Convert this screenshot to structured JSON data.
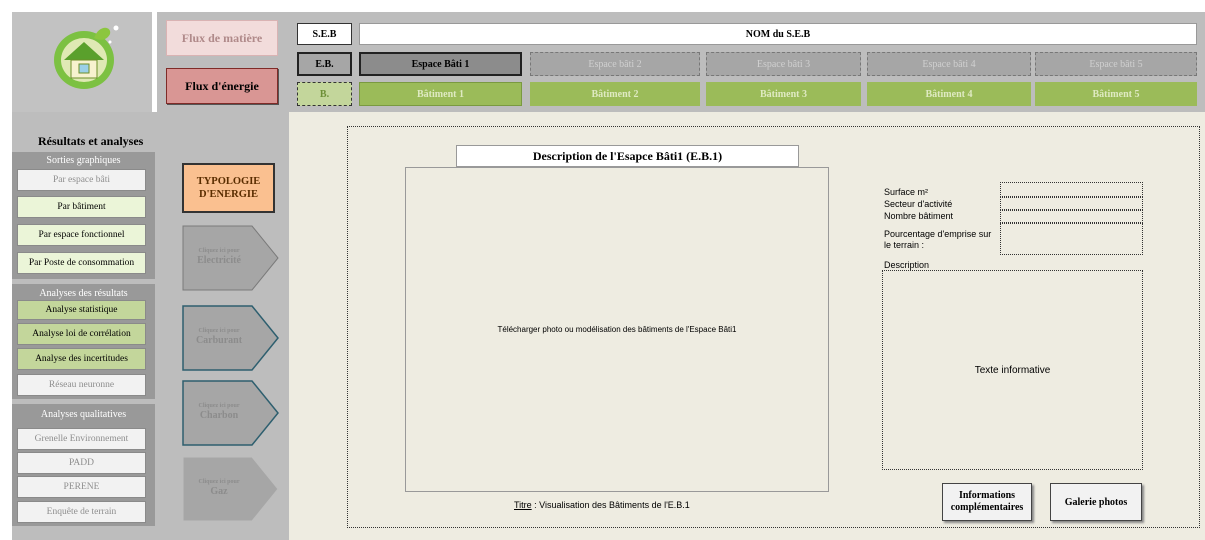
{
  "nav": {
    "flux_matiere": "Flux de matière",
    "flux_energie": "Flux d'énergie",
    "seb_label": "S.E.B",
    "seb_name": "NOM du S.E.B",
    "eb_label": "E.B.",
    "b_label": "B.",
    "espaces": [
      "Espace Bâti 1",
      "Espace bâti 2",
      "Espace bâti 3",
      "Espace bâti 4",
      "Espace bâti 5"
    ],
    "batiments": [
      "Bâtiment 1",
      "Bâtiment 2",
      "Bâtiment 3",
      "Bâtiment 4",
      "Bâtiment 5"
    ]
  },
  "sidebar": {
    "title": "Résultats et analyses",
    "graphiques_title": "Sorties graphiques",
    "graphiques": [
      "Par espace bâti",
      "Par bâtiment",
      "Par espace fonctionnel",
      "Par Poste de consommation"
    ],
    "resultats_title": "Analyses des résultats",
    "resultats": [
      "Analyse statistique",
      "Analyse loi de corrélation",
      "Analyse des incertitudes",
      "Réseau neuronne"
    ],
    "qualitatives_title": "Analyses qualitatives",
    "qualitatives": [
      "Grenelle Environnement",
      "PADD",
      "PERENE",
      "Enquête de terrain"
    ]
  },
  "energy": {
    "typologie": "TYPOLOGIE D'ENERGIE",
    "click_hint": "Cliquez ici pour",
    "types": [
      "Electricité",
      "Carburant",
      "Charbon",
      "Gaz"
    ]
  },
  "main": {
    "description_title": "Description de l'Esapce Bâti1 (E.B.1)",
    "photo_placeholder": "Télécharger photo ou modélisation des bâtiments de l'Espace Bâti1",
    "caption_prefix": "Titre",
    "caption_text": " : Visualisation des Bâtiments de l'E.B.1",
    "fields": {
      "surface": "Surface m²",
      "secteur": "Secteur d'activité",
      "nombre": "Nombre bâtiment",
      "pourcentage": "Pourcentage d'emprise sur le terrain :",
      "description": "Description"
    },
    "texte_informative": "Texte informative",
    "btn_informations": "Informations complémentaires",
    "btn_galerie": "Galerie photos"
  }
}
